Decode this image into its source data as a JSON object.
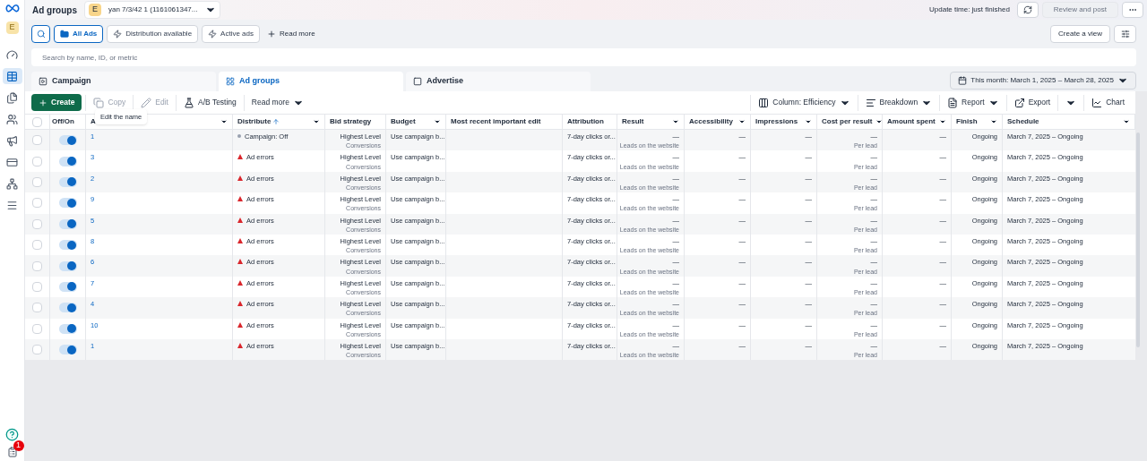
{
  "header": {
    "title": "Ad groups",
    "account_badge": "E",
    "account_name": "yan 7/3/42 1 (1161061347...",
    "update_time": "Update time: just finished",
    "review_button": "Review and post"
  },
  "sidebar": {
    "avatar": "E",
    "items": [
      {
        "kind": "gauge",
        "selected": false
      },
      {
        "kind": "table",
        "selected": true
      },
      {
        "kind": "pages",
        "selected": false
      },
      {
        "kind": "people",
        "selected": false
      },
      {
        "kind": "megaphone",
        "selected": false
      },
      {
        "kind": "card",
        "selected": false
      },
      {
        "kind": "network",
        "selected": false
      },
      {
        "kind": "menu",
        "selected": false
      }
    ],
    "notification_count": "1"
  },
  "filters": [
    {
      "label": "All Ads",
      "kind": "folder",
      "selected": true
    },
    {
      "label": "Distribution available",
      "kind": "bolt",
      "selected": false
    },
    {
      "label": "Active ads",
      "kind": "bolt",
      "selected": false
    }
  ],
  "read_more": "Read more",
  "create_view": "Create a view",
  "search": {
    "placeholder": "Search by name, ID, or metric"
  },
  "tabs": [
    {
      "label": "Campaign",
      "kind": "campaign",
      "selected": false
    },
    {
      "label": "Ad groups",
      "kind": "grid",
      "selected": true
    },
    {
      "label": "Advertise",
      "kind": "ad",
      "selected": false
    }
  ],
  "date_range": "This month: March 1, 2025 – March 28, 2025",
  "toolbar": {
    "create": "Create",
    "copy": {
      "label": "Copy",
      "disabled": true
    },
    "edit": {
      "label": "Edit",
      "disabled": true
    },
    "ab_testing": "A/B Testing",
    "read_more": "Read more",
    "column": "Column: Efficiency",
    "breakdown": "Breakdown",
    "report": "Report",
    "export": "Export",
    "chart": "Chart"
  },
  "tooltip": "Edit the name",
  "table": {
    "select_all": {
      "checked": false
    },
    "columns": [
      {
        "label": "Off/On",
        "menu": false,
        "sorted": false
      },
      {
        "label": "A",
        "menu": true,
        "sorted": false
      },
      {
        "label": "Distribute",
        "menu": true,
        "sorted": true
      },
      {
        "label": "Bid strategy",
        "menu": false,
        "sorted": false
      },
      {
        "label": "Budget",
        "menu": true,
        "sorted": false
      },
      {
        "label": "Most recent important edit",
        "menu": false,
        "sorted": false
      },
      {
        "label": "Attribution",
        "menu": false,
        "sorted": false
      },
      {
        "label": "Result",
        "menu": true,
        "sorted": false
      },
      {
        "label": "Accessibility",
        "menu": true,
        "sorted": false
      },
      {
        "label": "Impressions",
        "menu": true,
        "sorted": false
      },
      {
        "label": "Cost per result",
        "menu": true,
        "sorted": false
      },
      {
        "label": "Amount spent",
        "menu": true,
        "sorted": false
      },
      {
        "label": "Finish",
        "menu": true,
        "sorted": false
      },
      {
        "label": "Schedule",
        "menu": true,
        "sorted": false
      }
    ],
    "rows": [
      {
        "checked": false,
        "on": true,
        "name": "1",
        "status": {
          "kind": "off",
          "text": "Campaign: Off"
        },
        "bid": "Highest Level",
        "bid_sub": "Conversions",
        "budget": "Use campaign b...",
        "attribution": "7-day clicks or...",
        "result": "—",
        "result_sub": "Leads on the website",
        "accessibility": "—",
        "impressions": "—",
        "cost": "—",
        "cost_sub": "Per lead",
        "spent": "—",
        "finish": "Ongoing",
        "schedule": "March 7, 2025 – Ongoing"
      },
      {
        "checked": false,
        "on": true,
        "name": "3",
        "status": {
          "kind": "error",
          "text": "Ad errors"
        },
        "bid": "Highest Level",
        "bid_sub": "Conversions",
        "budget": "Use campaign b...",
        "attribution": "7-day clicks or...",
        "result": "—",
        "result_sub": "Leads on the website",
        "accessibility": "—",
        "impressions": "—",
        "cost": "—",
        "cost_sub": "Per lead",
        "spent": "—",
        "finish": "Ongoing",
        "schedule": "March 7, 2025 – Ongoing"
      },
      {
        "checked": false,
        "on": true,
        "name": "2",
        "status": {
          "kind": "error",
          "text": "Ad errors"
        },
        "bid": "Highest Level",
        "bid_sub": "Conversions",
        "budget": "Use campaign b...",
        "attribution": "7-day clicks or...",
        "result": "—",
        "result_sub": "Leads on the website",
        "accessibility": "—",
        "impressions": "—",
        "cost": "—",
        "cost_sub": "Per lead",
        "spent": "—",
        "finish": "Ongoing",
        "schedule": "March 7, 2025 – Ongoing"
      },
      {
        "checked": false,
        "on": true,
        "name": "9",
        "status": {
          "kind": "error",
          "text": "Ad errors"
        },
        "bid": "Highest Level",
        "bid_sub": "Conversions",
        "budget": "Use campaign b...",
        "attribution": "7-day clicks or...",
        "result": "—",
        "result_sub": "Leads on the website",
        "accessibility": "—",
        "impressions": "—",
        "cost": "—",
        "cost_sub": "Per lead",
        "spent": "—",
        "finish": "Ongoing",
        "schedule": "March 7, 2025 – Ongoing"
      },
      {
        "checked": false,
        "on": true,
        "name": "5",
        "status": {
          "kind": "error",
          "text": "Ad errors"
        },
        "bid": "Highest Level",
        "bid_sub": "Conversions",
        "budget": "Use campaign b...",
        "attribution": "7-day clicks or...",
        "result": "—",
        "result_sub": "Leads on the website",
        "accessibility": "—",
        "impressions": "—",
        "cost": "—",
        "cost_sub": "Per lead",
        "spent": "—",
        "finish": "Ongoing",
        "schedule": "March 7, 2025 – Ongoing"
      },
      {
        "checked": false,
        "on": true,
        "name": "8",
        "status": {
          "kind": "error",
          "text": "Ad errors"
        },
        "bid": "Highest Level",
        "bid_sub": "Conversions",
        "budget": "Use campaign b...",
        "attribution": "7-day clicks or...",
        "result": "—",
        "result_sub": "Leads on the website",
        "accessibility": "—",
        "impressions": "—",
        "cost": "—",
        "cost_sub": "Per lead",
        "spent": "—",
        "finish": "Ongoing",
        "schedule": "March 7, 2025 – Ongoing"
      },
      {
        "checked": false,
        "on": true,
        "name": "6",
        "status": {
          "kind": "error",
          "text": "Ad errors"
        },
        "bid": "Highest Level",
        "bid_sub": "Conversions",
        "budget": "Use campaign b...",
        "attribution": "7-day clicks or...",
        "result": "—",
        "result_sub": "Leads on the website",
        "accessibility": "—",
        "impressions": "—",
        "cost": "—",
        "cost_sub": "Per lead",
        "spent": "—",
        "finish": "Ongoing",
        "schedule": "March 7, 2025 – Ongoing"
      },
      {
        "checked": false,
        "on": true,
        "name": "7",
        "status": {
          "kind": "error",
          "text": "Ad errors"
        },
        "bid": "Highest Level",
        "bid_sub": "Conversions",
        "budget": "Use campaign b...",
        "attribution": "7-day clicks or...",
        "result": "—",
        "result_sub": "Leads on the website",
        "accessibility": "—",
        "impressions": "—",
        "cost": "—",
        "cost_sub": "Per lead",
        "spent": "—",
        "finish": "Ongoing",
        "schedule": "March 7, 2025 – Ongoing"
      },
      {
        "checked": false,
        "on": true,
        "name": "4",
        "status": {
          "kind": "error",
          "text": "Ad errors"
        },
        "bid": "Highest Level",
        "bid_sub": "Conversions",
        "budget": "Use campaign b...",
        "attribution": "7-day clicks or...",
        "result": "—",
        "result_sub": "Leads on the website",
        "accessibility": "—",
        "impressions": "—",
        "cost": "—",
        "cost_sub": "Per lead",
        "spent": "—",
        "finish": "Ongoing",
        "schedule": "March 7, 2025 – Ongoing"
      },
      {
        "checked": false,
        "on": true,
        "name": "10",
        "status": {
          "kind": "error",
          "text": "Ad errors"
        },
        "bid": "Highest Level",
        "bid_sub": "Conversions",
        "budget": "Use campaign b...",
        "attribution": "7-day clicks or...",
        "result": "—",
        "result_sub": "Leads on the website",
        "accessibility": "—",
        "impressions": "—",
        "cost": "—",
        "cost_sub": "Per lead",
        "spent": "—",
        "finish": "Ongoing",
        "schedule": "March 7, 2025 – Ongoing"
      },
      {
        "checked": false,
        "on": true,
        "name": "1",
        "status": {
          "kind": "error",
          "text": "Ad errors"
        },
        "bid": "Highest Level",
        "bid_sub": "Conversions",
        "budget": "Use campaign b...",
        "attribution": "7-day clicks or...",
        "result": "—",
        "result_sub": "Leads on the website",
        "accessibility": "—",
        "impressions": "—",
        "cost": "—",
        "cost_sub": "Per lead",
        "spent": "—",
        "finish": "Ongoing",
        "schedule": "March 7, 2025 – Ongoing"
      }
    ]
  }
}
